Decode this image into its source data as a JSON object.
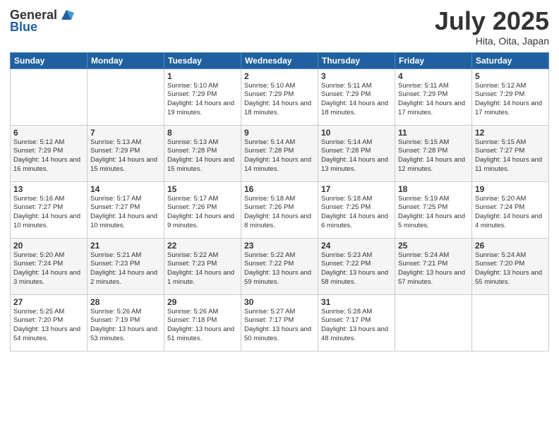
{
  "header": {
    "logo_general": "General",
    "logo_blue": "Blue",
    "month": "July 2025",
    "location": "Hita, Oita, Japan"
  },
  "weekdays": [
    "Sunday",
    "Monday",
    "Tuesday",
    "Wednesday",
    "Thursday",
    "Friday",
    "Saturday"
  ],
  "weeks": [
    [
      {
        "day": "",
        "info": ""
      },
      {
        "day": "",
        "info": ""
      },
      {
        "day": "1",
        "info": "Sunrise: 5:10 AM\nSunset: 7:29 PM\nDaylight: 14 hours and 19 minutes."
      },
      {
        "day": "2",
        "info": "Sunrise: 5:10 AM\nSunset: 7:29 PM\nDaylight: 14 hours and 18 minutes."
      },
      {
        "day": "3",
        "info": "Sunrise: 5:11 AM\nSunset: 7:29 PM\nDaylight: 14 hours and 18 minutes."
      },
      {
        "day": "4",
        "info": "Sunrise: 5:11 AM\nSunset: 7:29 PM\nDaylight: 14 hours and 17 minutes."
      },
      {
        "day": "5",
        "info": "Sunrise: 5:12 AM\nSunset: 7:29 PM\nDaylight: 14 hours and 17 minutes."
      }
    ],
    [
      {
        "day": "6",
        "info": "Sunrise: 5:12 AM\nSunset: 7:29 PM\nDaylight: 14 hours and 16 minutes."
      },
      {
        "day": "7",
        "info": "Sunrise: 5:13 AM\nSunset: 7:29 PM\nDaylight: 14 hours and 15 minutes."
      },
      {
        "day": "8",
        "info": "Sunrise: 5:13 AM\nSunset: 7:28 PM\nDaylight: 14 hours and 15 minutes."
      },
      {
        "day": "9",
        "info": "Sunrise: 5:14 AM\nSunset: 7:28 PM\nDaylight: 14 hours and 14 minutes."
      },
      {
        "day": "10",
        "info": "Sunrise: 5:14 AM\nSunset: 7:28 PM\nDaylight: 14 hours and 13 minutes."
      },
      {
        "day": "11",
        "info": "Sunrise: 5:15 AM\nSunset: 7:28 PM\nDaylight: 14 hours and 12 minutes."
      },
      {
        "day": "12",
        "info": "Sunrise: 5:15 AM\nSunset: 7:27 PM\nDaylight: 14 hours and 11 minutes."
      }
    ],
    [
      {
        "day": "13",
        "info": "Sunrise: 5:16 AM\nSunset: 7:27 PM\nDaylight: 14 hours and 10 minutes."
      },
      {
        "day": "14",
        "info": "Sunrise: 5:17 AM\nSunset: 7:27 PM\nDaylight: 14 hours and 10 minutes."
      },
      {
        "day": "15",
        "info": "Sunrise: 5:17 AM\nSunset: 7:26 PM\nDaylight: 14 hours and 9 minutes."
      },
      {
        "day": "16",
        "info": "Sunrise: 5:18 AM\nSunset: 7:26 PM\nDaylight: 14 hours and 8 minutes."
      },
      {
        "day": "17",
        "info": "Sunrise: 5:18 AM\nSunset: 7:25 PM\nDaylight: 14 hours and 6 minutes."
      },
      {
        "day": "18",
        "info": "Sunrise: 5:19 AM\nSunset: 7:25 PM\nDaylight: 14 hours and 5 minutes."
      },
      {
        "day": "19",
        "info": "Sunrise: 5:20 AM\nSunset: 7:24 PM\nDaylight: 14 hours and 4 minutes."
      }
    ],
    [
      {
        "day": "20",
        "info": "Sunrise: 5:20 AM\nSunset: 7:24 PM\nDaylight: 14 hours and 3 minutes."
      },
      {
        "day": "21",
        "info": "Sunrise: 5:21 AM\nSunset: 7:23 PM\nDaylight: 14 hours and 2 minutes."
      },
      {
        "day": "22",
        "info": "Sunrise: 5:22 AM\nSunset: 7:23 PM\nDaylight: 14 hours and 1 minute."
      },
      {
        "day": "23",
        "info": "Sunrise: 5:22 AM\nSunset: 7:22 PM\nDaylight: 13 hours and 59 minutes."
      },
      {
        "day": "24",
        "info": "Sunrise: 5:23 AM\nSunset: 7:22 PM\nDaylight: 13 hours and 58 minutes."
      },
      {
        "day": "25",
        "info": "Sunrise: 5:24 AM\nSunset: 7:21 PM\nDaylight: 13 hours and 57 minutes."
      },
      {
        "day": "26",
        "info": "Sunrise: 5:24 AM\nSunset: 7:20 PM\nDaylight: 13 hours and 55 minutes."
      }
    ],
    [
      {
        "day": "27",
        "info": "Sunrise: 5:25 AM\nSunset: 7:20 PM\nDaylight: 13 hours and 54 minutes."
      },
      {
        "day": "28",
        "info": "Sunrise: 5:26 AM\nSunset: 7:19 PM\nDaylight: 13 hours and 53 minutes."
      },
      {
        "day": "29",
        "info": "Sunrise: 5:26 AM\nSunset: 7:18 PM\nDaylight: 13 hours and 51 minutes."
      },
      {
        "day": "30",
        "info": "Sunrise: 5:27 AM\nSunset: 7:17 PM\nDaylight: 13 hours and 50 minutes."
      },
      {
        "day": "31",
        "info": "Sunrise: 5:28 AM\nSunset: 7:17 PM\nDaylight: 13 hours and 48 minutes."
      },
      {
        "day": "",
        "info": ""
      },
      {
        "day": "",
        "info": ""
      }
    ]
  ]
}
